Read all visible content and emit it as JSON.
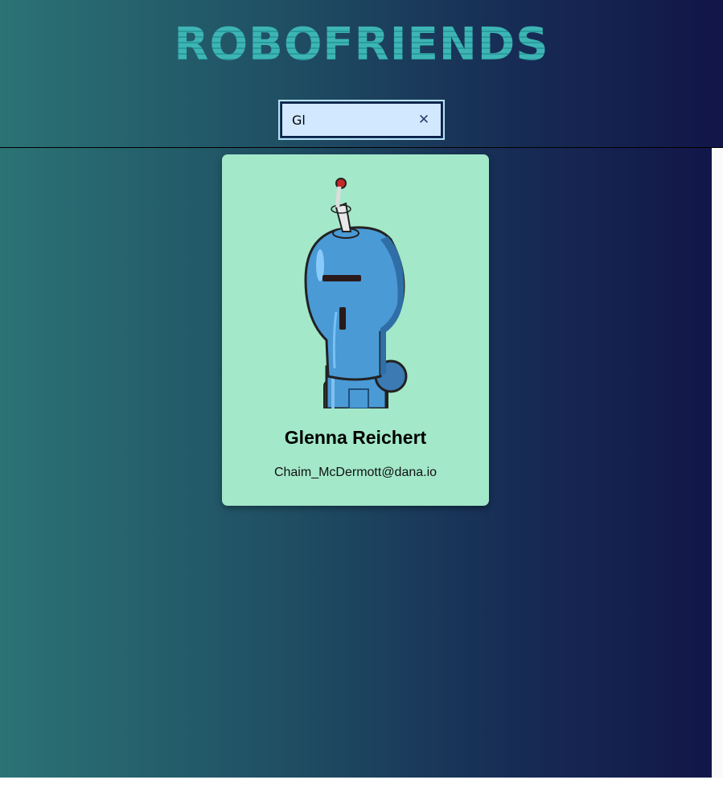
{
  "header": {
    "title": "ROBOFRIENDS"
  },
  "search": {
    "value": "Gl",
    "clear_icon": "close-icon",
    "clear_glyph": "✕"
  },
  "robots": [
    {
      "name": "Glenna Reichert",
      "email": "Chaim_McDermott@dana.io",
      "avatar_icon": "robot-avatar"
    }
  ],
  "colors": {
    "title": "#3db5b5",
    "card_bg": "#a3e8c9",
    "search_bg": "#d1e8ff",
    "search_border": "#0b1f4a",
    "gradient_start": "#2b7375",
    "gradient_end": "#121548"
  }
}
